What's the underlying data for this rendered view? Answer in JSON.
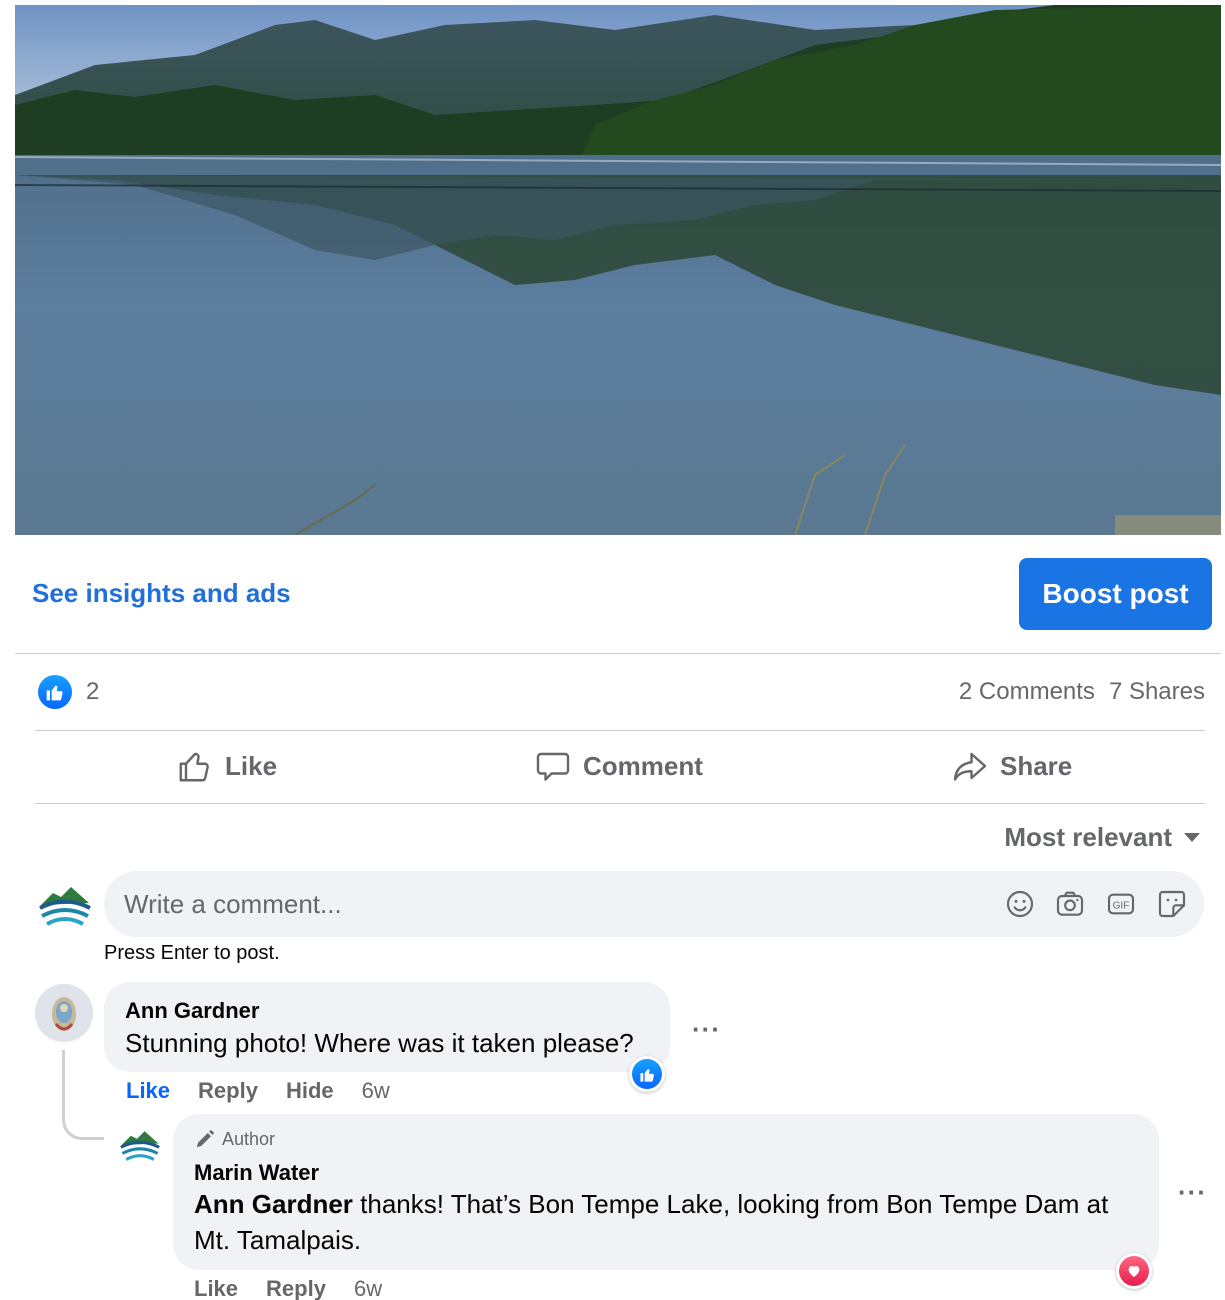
{
  "post": {
    "insights_link": "See insights and ads",
    "boost_button": "Boost post",
    "reaction_count": "2",
    "comments_count": "2 Comments",
    "shares_count": "7 Shares"
  },
  "actions": {
    "like": "Like",
    "comment": "Comment",
    "share": "Share"
  },
  "sort": {
    "label": "Most relevant"
  },
  "composer": {
    "placeholder": "Write a comment...",
    "hint": "Press Enter to post.",
    "tools": [
      "emoji-icon",
      "camera-icon",
      "gif-icon",
      "sticker-icon"
    ]
  },
  "comments": [
    {
      "author": "Ann Gardner",
      "text": "Stunning photo! Where was it taken please?",
      "actions": {
        "like": "Like",
        "reply": "Reply",
        "hide": "Hide"
      },
      "time": "6w",
      "reaction": "like"
    }
  ],
  "reply": {
    "badge": "Author",
    "author": "Marin Water",
    "mention": "Ann Gardner",
    "text": " thanks! That’s Bon Tempe Lake, looking from Bon Tempe Dam at Mt. Tamalpais.",
    "actions": {
      "like": "Like",
      "reply": "Reply"
    },
    "time": "6w",
    "reaction": "love"
  },
  "more_label": "···",
  "colors": {
    "accent_blue": "#1b74e4",
    "link_blue": "#216fdb",
    "secondary_text": "#65676b",
    "bubble_bg": "#f0f2f5",
    "love_red": "#e61e4d"
  }
}
